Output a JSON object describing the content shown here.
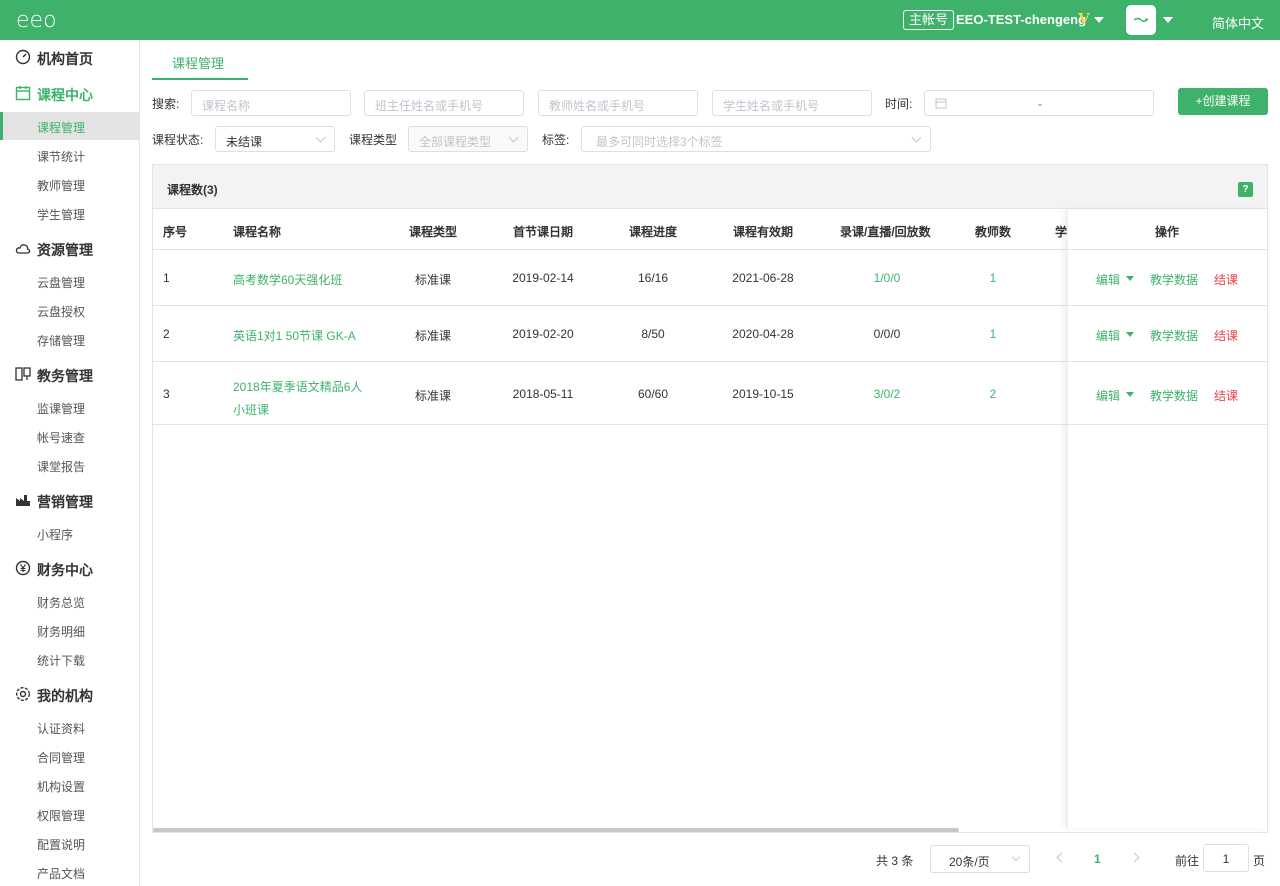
{
  "topbar": {
    "logo": "eeo",
    "account_badge": "主帐号",
    "account_name": "EEO-TEST-chengeng",
    "vip": "V",
    "language": "简体中文"
  },
  "sidebar": {
    "groups": [
      {
        "label": "机构首页",
        "icon": "dashboard-icon",
        "items": []
      },
      {
        "label": "课程中心",
        "icon": "calendar-icon",
        "items": [
          "课程管理",
          "课节统计",
          "教师管理",
          "学生管理"
        ]
      },
      {
        "label": "资源管理",
        "icon": "cloud-icon",
        "items": [
          "云盘管理",
          "云盘授权",
          "存储管理"
        ]
      },
      {
        "label": "教务管理",
        "icon": "monitor-icon",
        "items": [
          "监课管理",
          "帐号速查",
          "课堂报告"
        ]
      },
      {
        "label": "营销管理",
        "icon": "factory-icon",
        "items": [
          "小程序"
        ]
      },
      {
        "label": "财务中心",
        "icon": "yen-icon",
        "items": [
          "财务总览",
          "财务明细",
          "统计下载"
        ]
      },
      {
        "label": "我的机构",
        "icon": "gear-icon",
        "items": [
          "认证资料",
          "合同管理",
          "机构设置",
          "权限管理",
          "配置说明",
          "产品文档"
        ]
      }
    ],
    "active_group": "课程中心",
    "active_item": "课程管理"
  },
  "tab": {
    "label": "课程管理"
  },
  "filters": {
    "search_label": "搜索:",
    "course_name_placeholder": "课程名称",
    "head_teacher_placeholder": "班主任姓名或手机号",
    "teacher_placeholder": "教师姓名或手机号",
    "student_placeholder": "学生姓名或手机号",
    "time_label": "时间:",
    "date_separator": "-",
    "status_label": "课程状态:",
    "status_value": "未结课",
    "type_label": "课程类型",
    "type_placeholder": "全部课程类型",
    "tag_label": "标签:",
    "tag_placeholder": "最多可同时选择3个标签"
  },
  "create_button": "+创建课程",
  "table": {
    "title": "课程数(3)",
    "help": "?",
    "columns": [
      "序号",
      "课程名称",
      "课程类型",
      "首节课日期",
      "课程进度",
      "课程有效期",
      "录课/直播/回放数",
      "教师数",
      "学",
      "操作"
    ],
    "rows": [
      {
        "index": "1",
        "name": "高考数学60天强化班",
        "type": "标准课",
        "first_date": "2019-02-14",
        "progress": "16/16",
        "expiry": "2021-06-28",
        "counts": "1/0/0",
        "counts_green": true,
        "teachers": "1"
      },
      {
        "index": "2",
        "name": "英语1对1 50节课 GK-A",
        "type": "标准课",
        "first_date": "2019-02-20",
        "progress": "8/50",
        "expiry": "2020-04-28",
        "counts": "0/0/0",
        "counts_green": false,
        "teachers": "1"
      },
      {
        "index": "3",
        "name": "2018年夏季语文精品6人小班课",
        "type": "标准课",
        "first_date": "2018-05-11",
        "progress": "60/60",
        "expiry": "2019-10-15",
        "counts": "3/0/2",
        "counts_green": true,
        "teachers": "2"
      }
    ],
    "actions": {
      "edit": "编辑",
      "data": "教学数据",
      "close": "结课"
    }
  },
  "pagination": {
    "total": "共 3 条",
    "page_size": "20条/页",
    "current_page": "1",
    "goto_label": "前往",
    "goto_value": "1",
    "page_suffix": "页"
  },
  "colors": {
    "brand": "#3eb26b",
    "danger": "#e0474c"
  }
}
